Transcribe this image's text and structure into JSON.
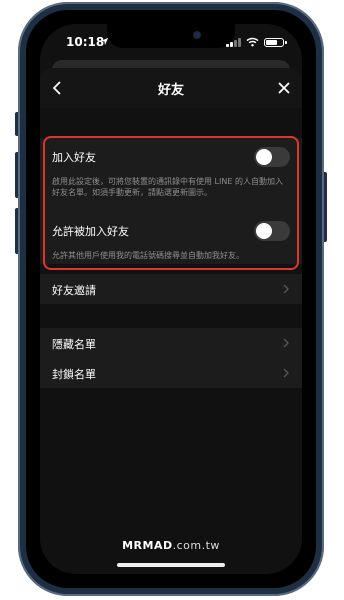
{
  "status_bar": {
    "time": "10:18",
    "location_icon": "location-arrow-icon",
    "signal_icon": "cellular-signal-icon",
    "wifi_icon": "wifi-icon",
    "battery_icon": "battery-icon"
  },
  "header": {
    "title": "好友",
    "back_icon": "chevron-left-icon",
    "close_icon": "close-icon"
  },
  "settings": {
    "add_friends": {
      "label": "加入好友",
      "enabled": false,
      "description": "啟用此設定後，可將您裝置的通訊錄中有使用 LINE 的人自動加入好友名單。如須手動更新，請點選更新圖示。"
    },
    "allow_others": {
      "label": "允許被加入好友",
      "enabled": false,
      "description": "允許其他用戶使用我的電話號碼搜尋並自動加我好友。"
    }
  },
  "menu": {
    "friend_requests": "好友邀請",
    "hidden_list": "隱藏名單",
    "blocked_list": "封鎖名單",
    "chevron_icon": "chevron-right-icon"
  },
  "watermark": {
    "brand": "MRMAD",
    "domain": ".com.tw"
  },
  "colors": {
    "background": "#111111",
    "row_background": "#1c1c1c",
    "highlight_border": "#e0352f",
    "text_primary": "#ffffff",
    "text_secondary": "#8e8e8e",
    "phone_frame": "#1e2f44"
  }
}
